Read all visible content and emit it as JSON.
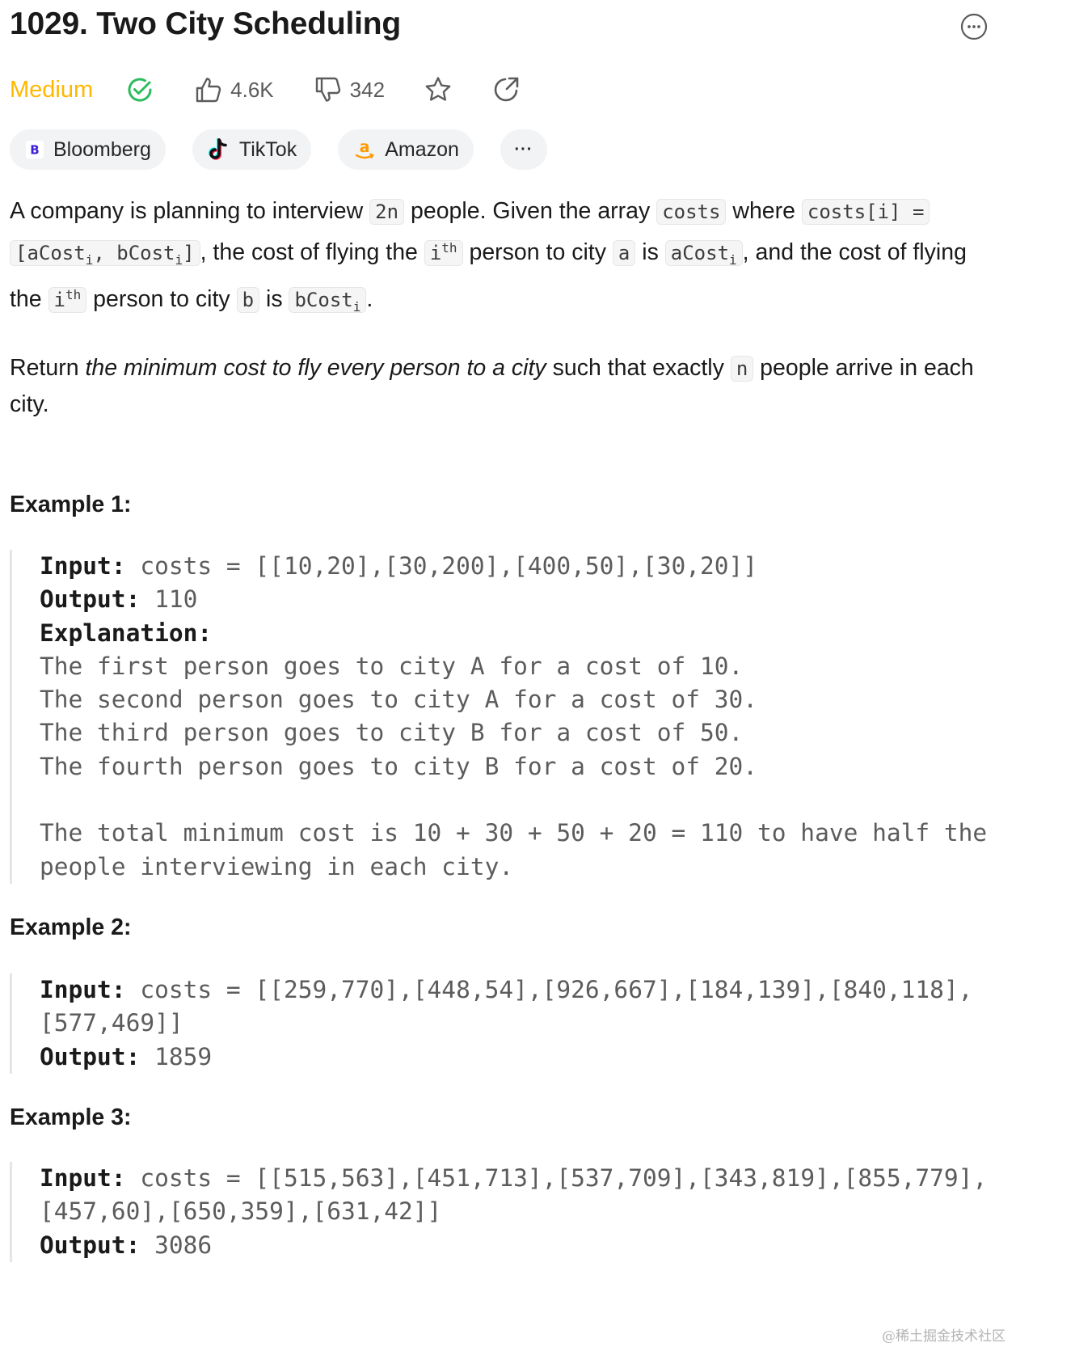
{
  "problem": {
    "title": "1029. Two City Scheduling",
    "difficulty": "Medium",
    "likes": "4.6K",
    "dislikes": "342",
    "colors": {
      "difficulty": "#ffb800",
      "solved": "#2cbb5d"
    }
  },
  "tags": [
    {
      "label": "Bloomberg",
      "icon": "bloomberg-logo"
    },
    {
      "label": "TikTok",
      "icon": "tiktok-logo"
    },
    {
      "label": "Amazon",
      "icon": "amazon-logo"
    }
  ],
  "more_tags_label": "···",
  "desc": {
    "p1": {
      "t1": "A company is planning to interview ",
      "c1": "2n",
      "t2": " people. Given the array ",
      "c2": "costs",
      "t3": " where ",
      "c3": "costs[i] =",
      "c4a": "[aCost",
      "c4sub1": "i",
      "c4b": ", bCost",
      "c4sub2": "i",
      "c4c": "]",
      "t4": ", the cost of flying the ",
      "c5a": "i",
      "c5sup": "th",
      "t5": " person to city ",
      "c6": "a",
      "t6": " is ",
      "c7a": "aCost",
      "c7sub": "i",
      "t7": ", and the cost of flying the ",
      "c8a": "i",
      "c8sup": "th",
      "t8": " person to city ",
      "c9": "b",
      "t9": " is ",
      "c10a": "bCost",
      "c10sub": "i",
      "t10": "."
    },
    "p2": {
      "t1": "Return ",
      "em": "the minimum cost to fly every person to a city",
      "t2": " such that exactly ",
      "c1": "n",
      "t3": " people arrive in each city."
    }
  },
  "examples": [
    {
      "heading": "Example 1:",
      "input_label": "Input:",
      "input": " costs = [[10,20],[30,200],[400,50],[30,20]]",
      "output_label": "Output:",
      "output": " 110",
      "explanation_label": "Explanation:",
      "explanation_lines": [
        "The first person goes to city A for a cost of 10.",
        "The second person goes to city A for a cost of 30.",
        "The third person goes to city B for a cost of 50.",
        "The fourth person goes to city B for a cost of 20."
      ],
      "summary": "The total minimum cost is 10 + 30 + 50 + 20 = 110 to have half the people interviewing in each city."
    },
    {
      "heading": "Example 2:",
      "input_label": "Input:",
      "input": " costs = [[259,770],[448,54],[926,667],[184,139],[840,118],[577,469]]",
      "output_label": "Output:",
      "output": " 1859"
    },
    {
      "heading": "Example 3:",
      "input_label": "Input:",
      "input": " costs = [[515,563],[451,713],[537,709],[343,819],[855,779],[457,60],[650,359],[631,42]]",
      "output_label": "Output:",
      "output": " 3086"
    }
  ],
  "watermark": "@稀土掘金技术社区"
}
